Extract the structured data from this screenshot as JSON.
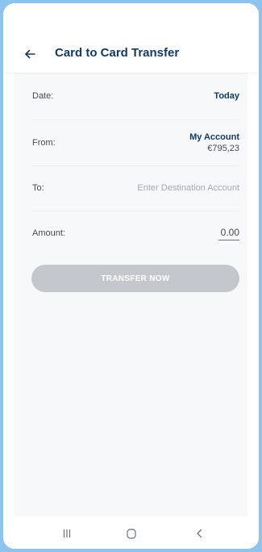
{
  "header": {
    "title": "Card to Card Transfer",
    "back_icon": "arrow-left-icon"
  },
  "form": {
    "date": {
      "label": "Date:",
      "value": "Today"
    },
    "from": {
      "label": "From:",
      "account": "My Account",
      "balance": "€795,23"
    },
    "to": {
      "label": "To:",
      "placeholder": "Enter Destination Account"
    },
    "amount": {
      "label": "Amount:",
      "value": "0.00"
    }
  },
  "actions": {
    "transfer_label": "TRANSFER NOW"
  },
  "navbar": {
    "recents_icon": "recents-icon",
    "home_icon": "home-icon",
    "back_icon": "back-icon"
  },
  "colors": {
    "frame": "#8cc4ef",
    "primary": "#123a64",
    "content_bg": "#f7f8f9",
    "button_disabled": "#c4c8cd"
  }
}
